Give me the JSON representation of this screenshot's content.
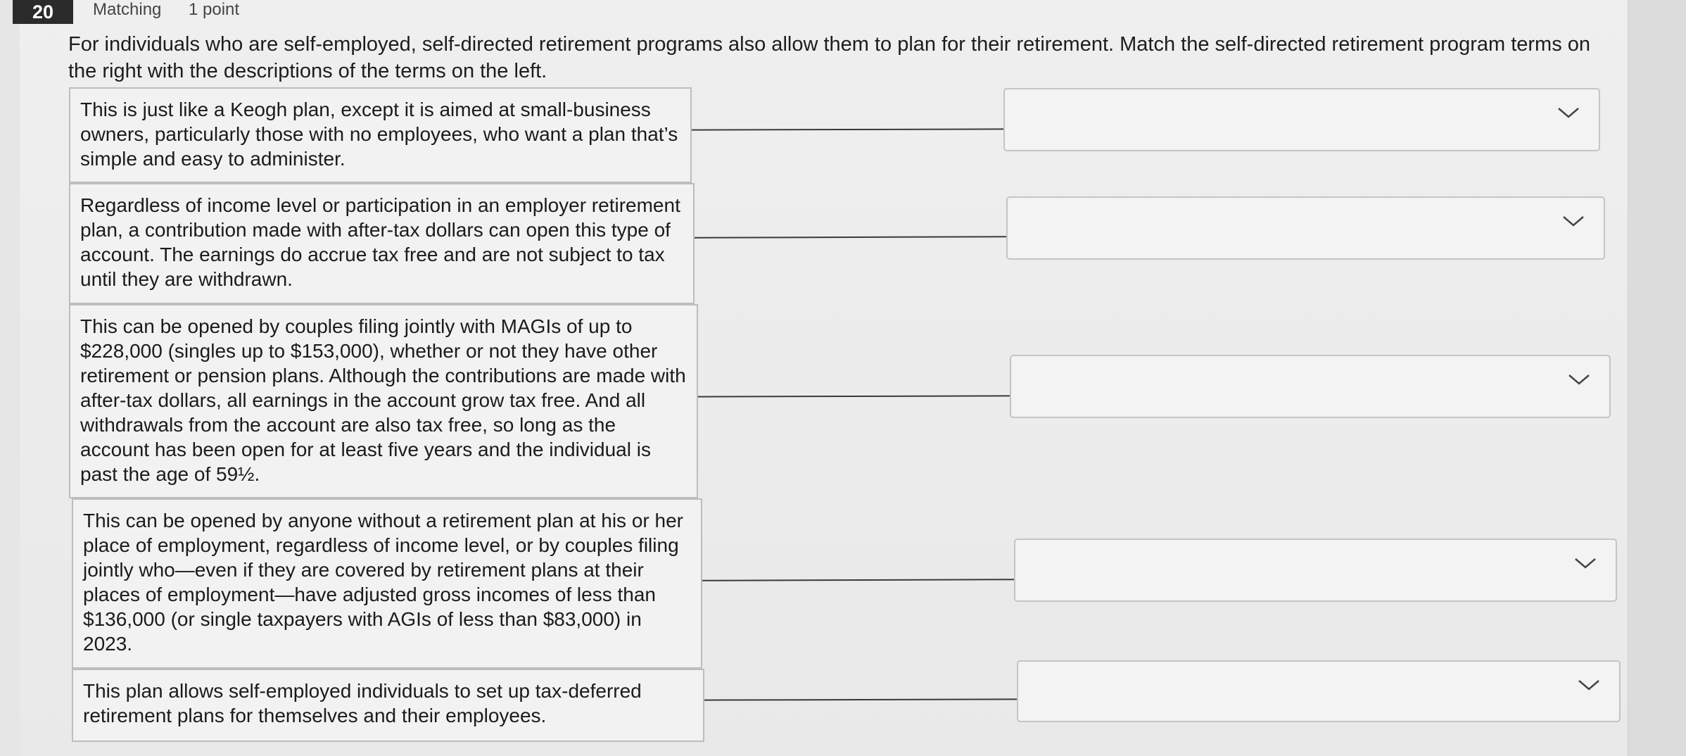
{
  "question": {
    "number": "20",
    "type": "Matching",
    "points": "1 point",
    "prompt": "For individuals who are self-employed, self-directed retirement programs also allow them to plan for their retirement. Match the self-directed retirement program terms on the right with the descriptions of the terms on the left."
  },
  "items": [
    {
      "description": "This is just like a Keogh plan, except it is aimed at small-business owners, particularly those with no employees, who want a plan that’s simple and easy to administer.",
      "selected": ""
    },
    {
      "description": "Regardless of income level or participation in an employer retirement plan, a contribution made with after-tax dollars can open this type of account. The earnings do accrue tax free and are not subject to tax until they are withdrawn.",
      "selected": ""
    },
    {
      "description": "This can be opened by couples filing jointly with MAGIs of up to $228,000 (singles up to $153,000), whether or not they have other retirement or pension plans. Although the contributions are made with after-tax dollars, all earnings in the account grow tax free. And all withdrawals from the account are also tax free, so long as the account has been open for at least five years and the individual is past the age of 59½.",
      "selected": ""
    },
    {
      "description": "This can be opened by anyone without a retirement plan at his or her place of employment, regardless of income level, or by couples filing jointly who—even if they are covered by retirement plans at their places of employment—have adjusted gross incomes of less than $136,000 (or single taxpayers with AGIs of less than $83,000) in 2023.",
      "selected": ""
    },
    {
      "description": "This plan allows self-employed individuals to set up tax-deferred retirement plans for themselves and their employees.",
      "selected": ""
    }
  ],
  "icons": {
    "dropdown": "chevron-down-icon"
  }
}
